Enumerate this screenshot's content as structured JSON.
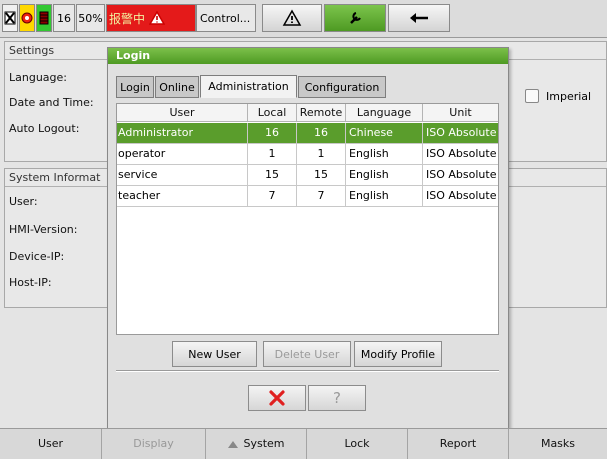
{
  "topbar": {
    "counter": "16",
    "percent": "50%",
    "alarm_text": "报警中",
    "control_label": "Control...",
    "icons": [
      "stop-icon",
      "emergency-icon",
      "battery-icon",
      "warning-icon",
      "warning-triangle-icon",
      "wrench-icon",
      "back-arrow-icon"
    ]
  },
  "settings_panel": {
    "title": "Settings",
    "language_label": "Language:",
    "datetime_label": "Date and Time:",
    "autologout_label": "Auto Logout:",
    "imperial_label": "Imperial"
  },
  "system_panel": {
    "title": "System Informat",
    "user_label": "User:",
    "hmi_label": "HMI-Version:",
    "device_label": "Device-IP:",
    "host_label": "Host-IP:"
  },
  "dialog": {
    "title": "Login",
    "tabs": [
      "Login",
      "Online",
      "Administration",
      "Configuration"
    ],
    "active_tab": "Administration",
    "columns": [
      "User",
      "Local",
      "Remote",
      "Language",
      "Unit"
    ],
    "rows": [
      {
        "user": "Administrator",
        "local": "16",
        "remote": "16",
        "language": "Chinese",
        "unit": "ISO Absolute",
        "selected": true
      },
      {
        "user": "operator",
        "local": "1",
        "remote": "1",
        "language": "English",
        "unit": "ISO Absolute",
        "selected": false
      },
      {
        "user": "service",
        "local": "15",
        "remote": "15",
        "language": "English",
        "unit": "ISO Absolute",
        "selected": false
      },
      {
        "user": "teacher",
        "local": "7",
        "remote": "7",
        "language": "English",
        "unit": "ISO Absolute",
        "selected": false
      }
    ],
    "buttons": {
      "new_user": "New User",
      "delete_user": "Delete User",
      "modify_profile": "Modify Profile",
      "help": "?"
    }
  },
  "bottombar": {
    "user": "User",
    "display": "Display",
    "system": "System",
    "lock": "Lock",
    "report": "Report",
    "masks": "Masks"
  },
  "colors": {
    "accent_green": "#5a9d2c",
    "alarm_red": "#e41a1a",
    "cancel_red": "#e02020"
  }
}
